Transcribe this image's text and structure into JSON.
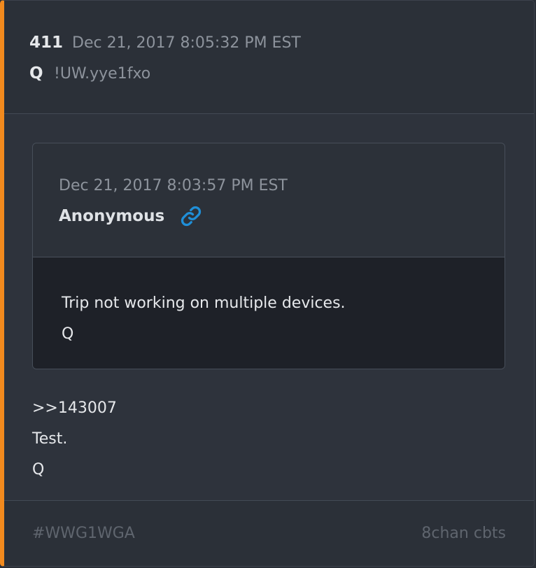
{
  "post": {
    "number": "411",
    "date": "Dec 21, 2017 8:05:32 PM EST",
    "author": "Q",
    "tripcode": "!UW.yye1fxo"
  },
  "quoted_post": {
    "date": "Dec 21, 2017 8:03:57 PM EST",
    "author": "Anonymous",
    "link_icon": "link-icon",
    "lines": [
      "Trip not working on multiple devices.",
      "Q"
    ]
  },
  "body": {
    "backlink": ">>143007",
    "lines": [
      "Test.",
      "Q"
    ]
  },
  "footer": {
    "hashtag": "#WWG1WGA",
    "source": "8chan cbts"
  },
  "colors": {
    "accent_bar": "#f28a1e",
    "link_icon": "#1f8fd8"
  }
}
